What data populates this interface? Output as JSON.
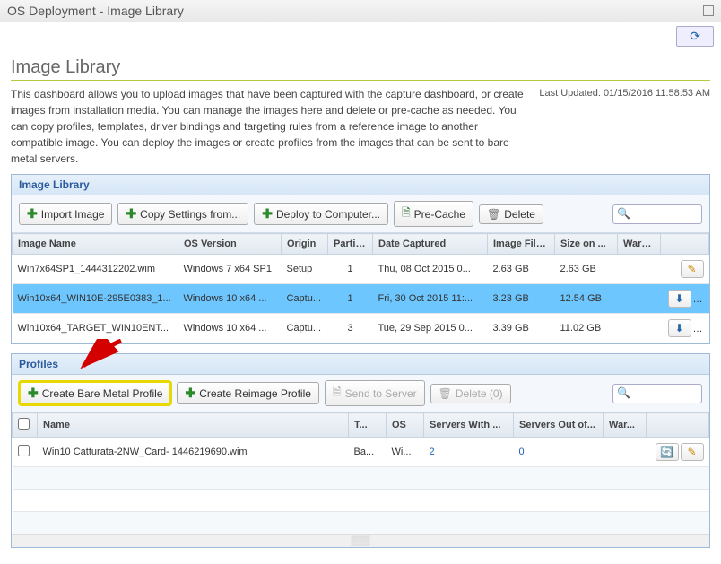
{
  "titlebar": {
    "title": "OS Deployment - Image Library"
  },
  "refresh_glyph": "⟳",
  "page": {
    "title": "Image Library"
  },
  "description": "This dashboard allows you to upload images that have been captured with the capture dashboard, or create images from installation media. You can manage the images here and delete or pre-cache as needed. You can copy profiles, templates, driver bindings and targeting rules from a reference image to another compatible image. You can deploy the images or create profiles from the images that can be sent to bare metal servers.",
  "last_updated": "Last Updated: 01/15/2016 11:58:53 AM",
  "image_library": {
    "header": "Image Library",
    "buttons": {
      "import": "Import Image",
      "copy_settings": "Copy Settings from...",
      "deploy": "Deploy to Computer...",
      "precache": "Pre-Cache",
      "delete": "Delete"
    },
    "columns": [
      "Image Name",
      "OS Version",
      "Origin",
      "Partit...",
      "Date Captured",
      "Image File...",
      "Size on ...",
      "Warni..."
    ],
    "rows": [
      {
        "name": "Win7x64SP1_1444312202.wim",
        "os": "Windows 7 x64 SP1",
        "origin": "Setup",
        "part": "1",
        "date": "Thu, 08 Oct 2015 0...",
        "file": "2.63 GB",
        "disk": "2.63 GB",
        "warn": ""
      },
      {
        "name": "Win10x64_WIN10E-295E0383_1...",
        "os": "Windows 10 x64 ...",
        "origin": "Captu...",
        "part": "1",
        "date": "Fri, 30 Oct 2015 11:...",
        "file": "3.23 GB",
        "disk": "12.54 GB",
        "warn": ""
      },
      {
        "name": "Win10x64_TARGET_WIN10ENT...",
        "os": "Windows 10 x64 ...",
        "origin": "Captu...",
        "part": "3",
        "date": "Tue, 29 Sep 2015 0...",
        "file": "3.39 GB",
        "disk": "11.02 GB",
        "warn": ""
      }
    ]
  },
  "profiles": {
    "header": "Profiles",
    "buttons": {
      "create_bare": "Create Bare Metal Profile",
      "create_reimage": "Create Reimage Profile",
      "send": "Send to Server",
      "delete": "Delete (0)"
    },
    "columns": [
      "",
      "Name",
      "T...",
      "OS",
      "Servers With ...",
      "Servers Out of...",
      "War..."
    ],
    "rows": [
      {
        "name": "Win10 Catturata-2NW_Card- 1446219690.wim",
        "t": "Ba...",
        "os": "Wi...",
        "with": "2",
        "out": "0",
        "war": ""
      }
    ]
  },
  "glyphs": {
    "plus": "✚",
    "doc": "🗎",
    "trash": "🗑",
    "download": "⬇",
    "pencil": "✎",
    "cycle": "🔄",
    "mag": "🔍"
  },
  "search_placeholder": ""
}
